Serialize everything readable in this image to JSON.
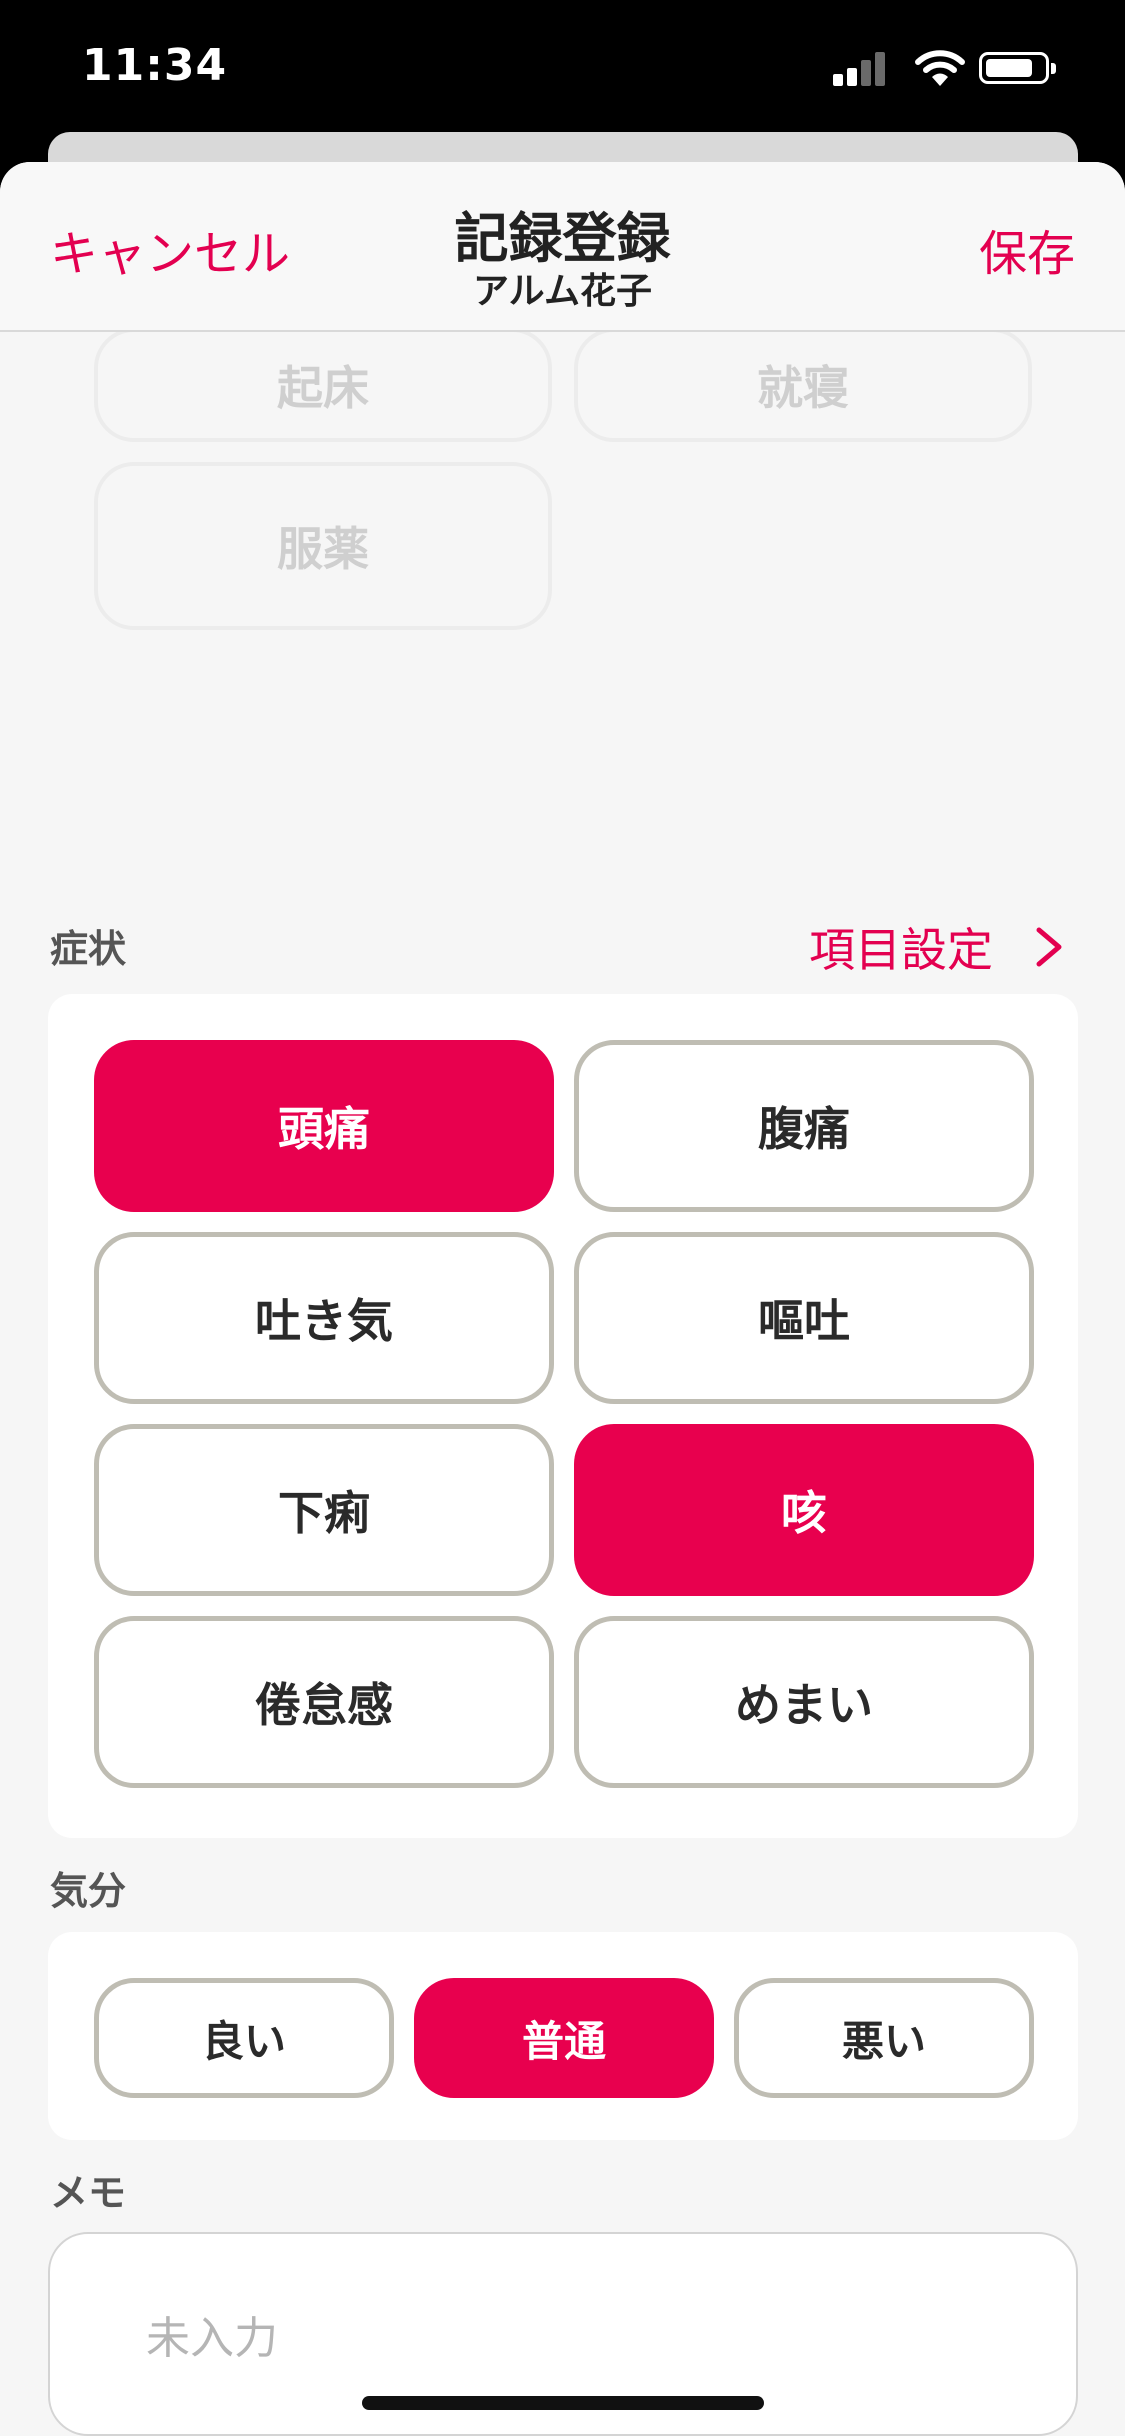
{
  "status_bar": {
    "time": "11:34",
    "icons": [
      "signal-icon",
      "wifi-icon",
      "battery-icon"
    ]
  },
  "nav": {
    "cancel_label": "キャンセル",
    "title": "記録登録",
    "subtitle": "アルム花子",
    "save_label": "保存"
  },
  "event_buttons": {
    "wake": "起床",
    "sleep": "就寝",
    "medication": "服薬"
  },
  "symptoms": {
    "label": "症状",
    "settings_label": "項目設定",
    "items": [
      {
        "label": "頭痛",
        "selected": true
      },
      {
        "label": "腹痛",
        "selected": false
      },
      {
        "label": "吐き気",
        "selected": false
      },
      {
        "label": "嘔吐",
        "selected": false
      },
      {
        "label": "下痢",
        "selected": false
      },
      {
        "label": "咳",
        "selected": true
      },
      {
        "label": "倦怠感",
        "selected": false
      },
      {
        "label": "めまい",
        "selected": false
      }
    ]
  },
  "mood": {
    "label": "気分",
    "options": [
      {
        "label": "良い",
        "selected": false
      },
      {
        "label": "普通",
        "selected": true
      },
      {
        "label": "悪い",
        "selected": false
      }
    ]
  },
  "memo": {
    "label": "メモ",
    "placeholder": "未入力"
  },
  "colors": {
    "accent": "#e8004e",
    "link": "#e30050",
    "tile_border": "#bfbdb3",
    "background": "#f6f6f6"
  }
}
